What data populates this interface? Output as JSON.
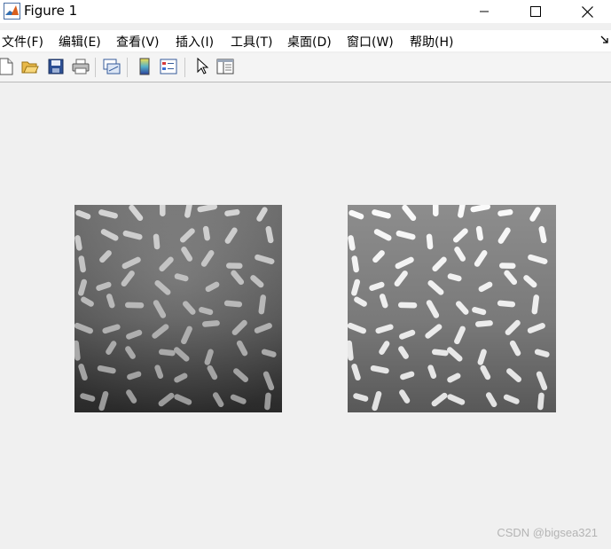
{
  "window": {
    "title": "Figure 1"
  },
  "menu": [
    {
      "label": "文件(F)",
      "name": "menu-file"
    },
    {
      "label": "编辑(E)",
      "name": "menu-edit"
    },
    {
      "label": "查看(V)",
      "name": "menu-view"
    },
    {
      "label": "插入(I)",
      "name": "menu-insert"
    },
    {
      "label": "工具(T)",
      "name": "menu-tools"
    },
    {
      "label": "桌面(D)",
      "name": "menu-desktop"
    },
    {
      "label": "窗口(W)",
      "name": "menu-window"
    },
    {
      "label": "帮助(H)",
      "name": "menu-help"
    }
  ],
  "toolbar": {
    "icons": [
      "new-figure-icon",
      "open-file-icon",
      "save-icon",
      "print-icon",
      "link-plot-icon",
      "colorbar-icon",
      "legend-icon",
      "select-pointer-icon",
      "property-inspector-icon"
    ]
  },
  "images": [
    {
      "name": "original-rice-image",
      "description_label": ""
    },
    {
      "name": "enhanced-rice-image",
      "description_label": ""
    }
  ],
  "watermark": "CSDN @bigsea321"
}
